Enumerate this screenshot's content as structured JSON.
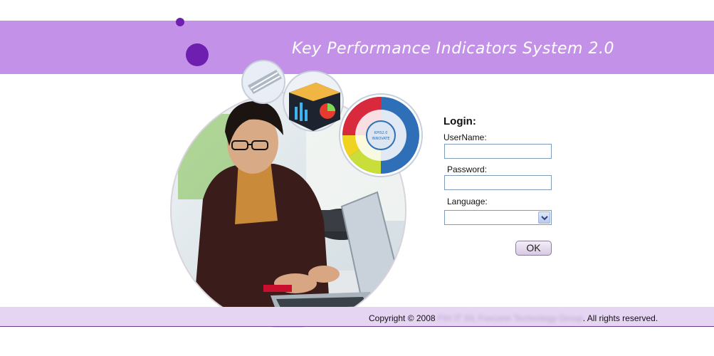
{
  "header": {
    "title": "Key Performance Indicators System 2.0"
  },
  "hero": {
    "wheel_center_text": "KPIS2.0 INNOVATE"
  },
  "login": {
    "title": "Login:",
    "username_label": "UserName:",
    "username_value": "",
    "password_label": "Password:",
    "password_value": "",
    "language_label": "Language:",
    "language_selected": "",
    "ok_label": "OK"
  },
  "footer": {
    "copyright_prefix": "Copyright © 2008",
    "company": "FIH IT SIL Foxconn Technology Group",
    "suffix": ". All rights reserved."
  },
  "colors": {
    "header_band": "#c392e8",
    "accent_dot": "#6e1fb0",
    "footer_band": "#e6d4f3"
  },
  "icons": [
    "chevron-down-icon"
  ]
}
